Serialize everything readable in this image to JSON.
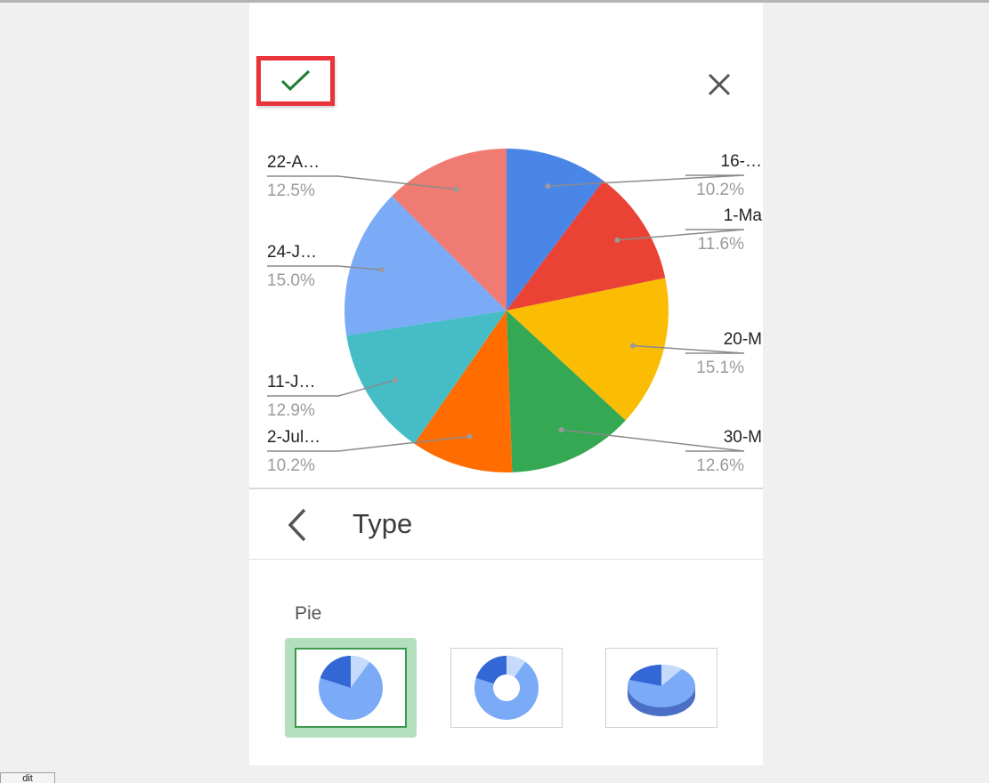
{
  "header": {
    "confirm_icon": "checkmark-icon",
    "close_icon": "close-icon",
    "accent_check": "#1e7e34",
    "highlight_border": "#e8333a"
  },
  "chart_data": {
    "type": "pie",
    "slices": [
      {
        "label": "16-…",
        "value": 10.2,
        "pct": "10.2%",
        "color": "#4a86e8"
      },
      {
        "label": "1-Ma",
        "value": 11.6,
        "pct": "11.6%",
        "color": "#ea4335"
      },
      {
        "label": "20-M",
        "value": 15.1,
        "pct": "15.1%",
        "color": "#fbbc04"
      },
      {
        "label": "30-M",
        "value": 12.6,
        "pct": "12.6%",
        "color": "#34a853"
      },
      {
        "label": "2-Jul…",
        "value": 10.2,
        "pct": "10.2%",
        "color": "#ff6d01"
      },
      {
        "label": "11-J…",
        "value": 12.9,
        "pct": "12.9%",
        "color": "#46bdc6"
      },
      {
        "label": "24-J…",
        "value": 15.0,
        "pct": "15.0%",
        "color": "#7baaf7"
      },
      {
        "label": "22-A…",
        "value": 12.5,
        "pct": "12.5%",
        "color": "#f07b72"
      }
    ]
  },
  "section": {
    "back_icon": "chevron-left-icon",
    "title": "Type"
  },
  "types": {
    "group_label": "Pie",
    "options": [
      {
        "name": "pie",
        "selected": true
      },
      {
        "name": "donut",
        "selected": false
      },
      {
        "name": "3d-pie",
        "selected": false
      }
    ],
    "selected_bg": "#b3dfbc"
  },
  "footer": {
    "tab_label": "dit"
  }
}
